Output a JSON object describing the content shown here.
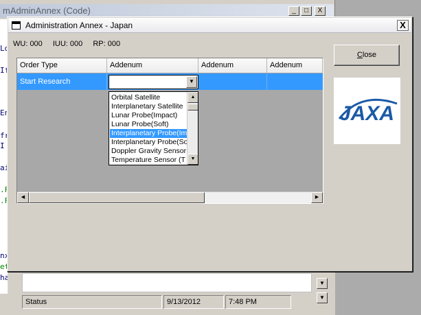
{
  "background_window": {
    "title": "mAdminAnnex (Code)",
    "minimize": "_",
    "maximize": "□",
    "close": "X",
    "code_fragments": [
      {
        "text": "Lo",
        "color": "#000070"
      },
      {
        "text": "If",
        "color": "#000070"
      },
      {
        "text": "En",
        "color": "#000070"
      },
      {
        "text": "fr",
        "color": "#000070"
      },
      {
        "text": " I",
        "color": "#000070"
      },
      {
        "text": "ai",
        "color": "#000070"
      },
      {
        "text": ".F",
        "color": "#008000"
      },
      {
        "text": ".F",
        "color": "#008000"
      },
      {
        "text": "nx",
        "color": "#000070"
      },
      {
        "text": "et",
        "color": "#008000"
      },
      {
        "text": "han",
        "color": "#000070"
      }
    ],
    "status": {
      "text": "Status",
      "date": "9/13/2012",
      "time": "7:48 PM"
    }
  },
  "dialog": {
    "title": "Administration Annex - Japan",
    "close_glyph": "X",
    "counters": {
      "wu": "WU: 000",
      "iuu": "IUU: 000",
      "rp": "RP: 000"
    },
    "grid": {
      "columns": [
        "Order Type",
        "Addenum",
        "Addenum",
        "Addenum"
      ],
      "rows": [
        {
          "order_type": "Start Research",
          "addenum1": "",
          "addenum2": "",
          "addenum3": ""
        }
      ],
      "combo_value": "",
      "dropdown_options": [
        "Orbital Satellite",
        "Interplanetary Satellite",
        "Lunar Probe(Impact)",
        "Lunar Probe(Soft)",
        "Interplanetary Probe(Im",
        "Interplanetary Probe(So",
        "Doppler Gravity Sensor",
        "Temperature Sensor (T"
      ],
      "selected_option_index": 4
    },
    "close_button": {
      "underlined": "C",
      "rest": "lose"
    },
    "logo": {
      "text": "JAXA",
      "color": "#1b5aa6"
    }
  }
}
